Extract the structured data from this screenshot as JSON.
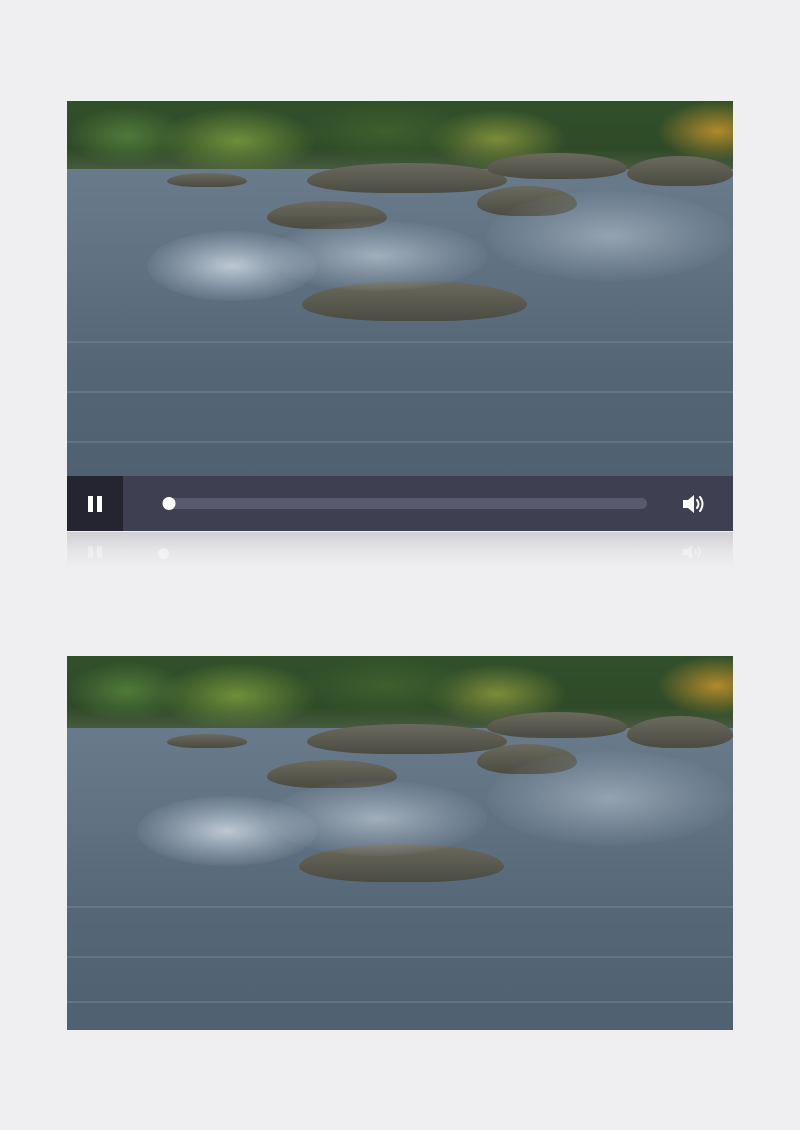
{
  "player": {
    "state": "playing",
    "progress_fraction": 0.0,
    "controls": {
      "play_pause_icon": "pause-icon",
      "volume_icon": "volume-icon"
    },
    "colors": {
      "control_bar": "#3f3f52",
      "pause_button_bg": "#252531",
      "track": "#5a5a6e",
      "foreground": "#ffffff",
      "page_background": "#efeff1"
    }
  },
  "frames": [
    {
      "scene": "river-rapids-video-frame"
    },
    {
      "scene": "river-rapids-still-frame"
    }
  ]
}
